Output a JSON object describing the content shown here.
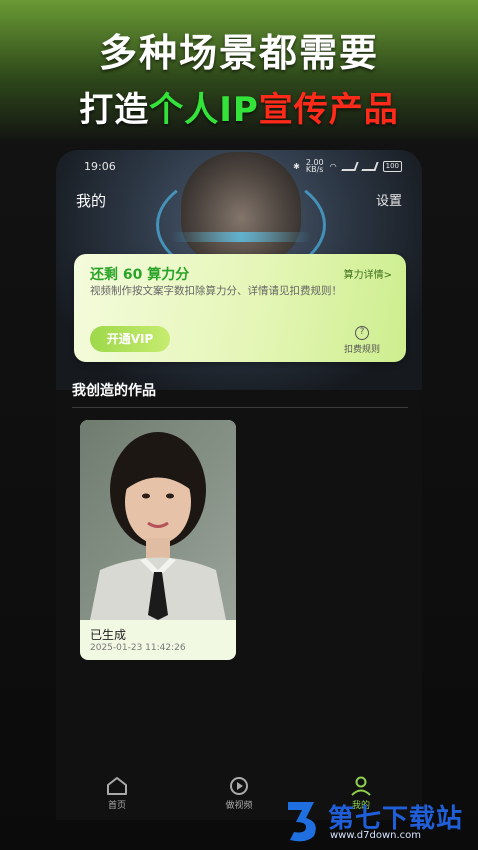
{
  "promo": {
    "headline": "多种场景都需要",
    "subhead_part1": "打造",
    "subhead_part2": "个人IP",
    "subhead_part3": "宣传产品"
  },
  "statusbar": {
    "time": "19:06",
    "net_speed": "2.00\nKB/s",
    "battery": "100"
  },
  "nav": {
    "title": "我的",
    "settings": "设置"
  },
  "power_card": {
    "title": "还剩 60 算力分",
    "details_link": "算力详情>",
    "description": "视频制作按文案字数扣除算力分、详情请见扣费规则！",
    "vip_button": "开通VIP",
    "rules_label": "扣费规则",
    "rules_icon": "question-circle-icon"
  },
  "works": {
    "section_title": "我创造的作品",
    "items": [
      {
        "status": "已生成",
        "timestamp": "2025-01-23 11:42:26"
      }
    ]
  },
  "tabbar": {
    "items": [
      {
        "label": "首页",
        "icon": "home-icon",
        "active": false
      },
      {
        "label": "做视频",
        "icon": "video-play-icon",
        "active": false
      },
      {
        "label": "我的",
        "icon": "user-icon",
        "active": true
      }
    ]
  },
  "watermark": {
    "name": "第七下载站",
    "url": "www.d7down.com"
  },
  "colors": {
    "accent_green": "#34e33a",
    "accent_red": "#ff2a1a",
    "vip_green": "#9ed84a",
    "active_tab": "#8fd14f"
  }
}
